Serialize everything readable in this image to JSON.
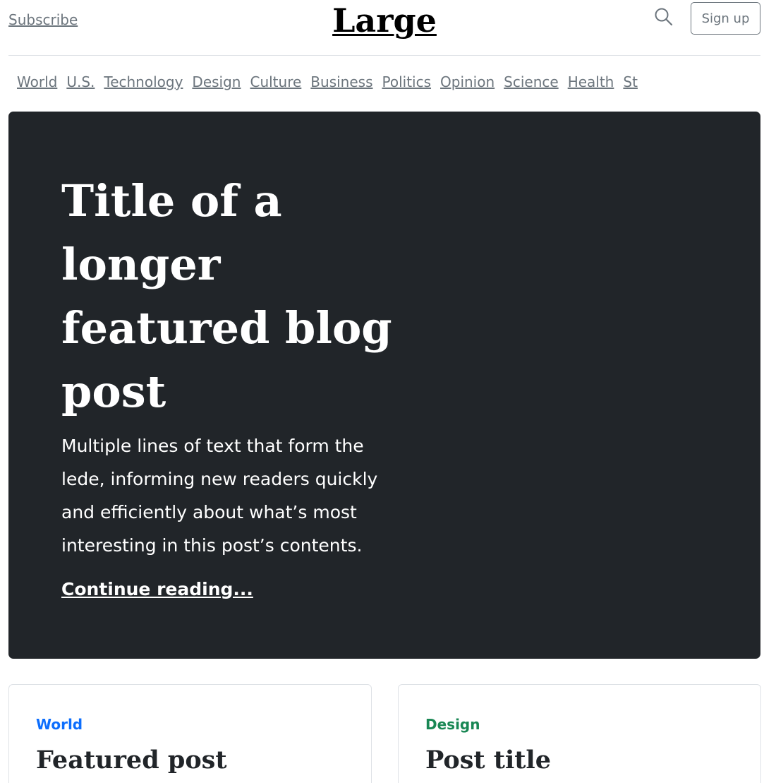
{
  "header": {
    "subscribe_label": "Subscribe",
    "logo_text": "Large",
    "signup_label": "Sign up"
  },
  "nav": {
    "items": [
      "World",
      "U.S.",
      "Technology",
      "Design",
      "Culture",
      "Business",
      "Politics",
      "Opinion",
      "Science",
      "Health",
      "St"
    ]
  },
  "hero": {
    "title": "Title of a longer featured blog post",
    "lede": "Multiple lines of text that form the lede, informing new readers quickly and efficiently about what’s most interesting in this post’s contents.",
    "link_label": "Continue reading..."
  },
  "cards": [
    {
      "category": "World",
      "category_color": "#0d6efd",
      "title": "Featured post"
    },
    {
      "category": "Design",
      "category_color": "#198754",
      "title": "Post title"
    }
  ],
  "colors": {
    "hero_background": "#212529",
    "muted_text": "#6c757d"
  }
}
